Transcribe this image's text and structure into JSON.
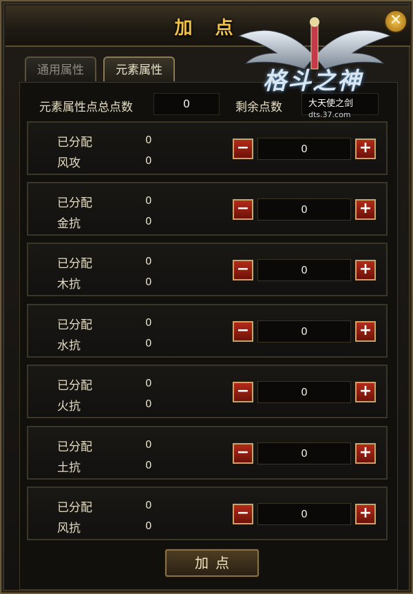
{
  "window": {
    "title": "加 点",
    "close_icon": "close-icon"
  },
  "tabs": [
    {
      "label": "通用属性",
      "active": false
    },
    {
      "label": "元素属性",
      "active": true
    }
  ],
  "summary": {
    "total_label": "元素属性点总点数",
    "total_value": "0",
    "remain_label": "剩余点数",
    "remain_value": ""
  },
  "logo": {
    "title": "格斗之神",
    "subtitle": "大天使之剑",
    "url": "dts.37.com"
  },
  "rows": [
    {
      "allocated_label": "已分配",
      "allocated_value": "0",
      "stat_label": "风攻",
      "stat_value": "0",
      "input": "0"
    },
    {
      "allocated_label": "已分配",
      "allocated_value": "0",
      "stat_label": "金抗",
      "stat_value": "0",
      "input": "0"
    },
    {
      "allocated_label": "已分配",
      "allocated_value": "0",
      "stat_label": "木抗",
      "stat_value": "0",
      "input": "0"
    },
    {
      "allocated_label": "已分配",
      "allocated_value": "0",
      "stat_label": "水抗",
      "stat_value": "0",
      "input": "0"
    },
    {
      "allocated_label": "已分配",
      "allocated_value": "0",
      "stat_label": "火抗",
      "stat_value": "0",
      "input": "0"
    },
    {
      "allocated_label": "已分配",
      "allocated_value": "0",
      "stat_label": "土抗",
      "stat_value": "0",
      "input": "0"
    },
    {
      "allocated_label": "已分配",
      "allocated_value": "0",
      "stat_label": "风抗",
      "stat_value": "0",
      "input": "0"
    }
  ],
  "buttons": {
    "minus": "−",
    "plus": "+",
    "apply": "加点"
  },
  "colors": {
    "accent": "#f0c24a",
    "button_red": "#b32a1a",
    "frame": "#6b5a3a"
  }
}
